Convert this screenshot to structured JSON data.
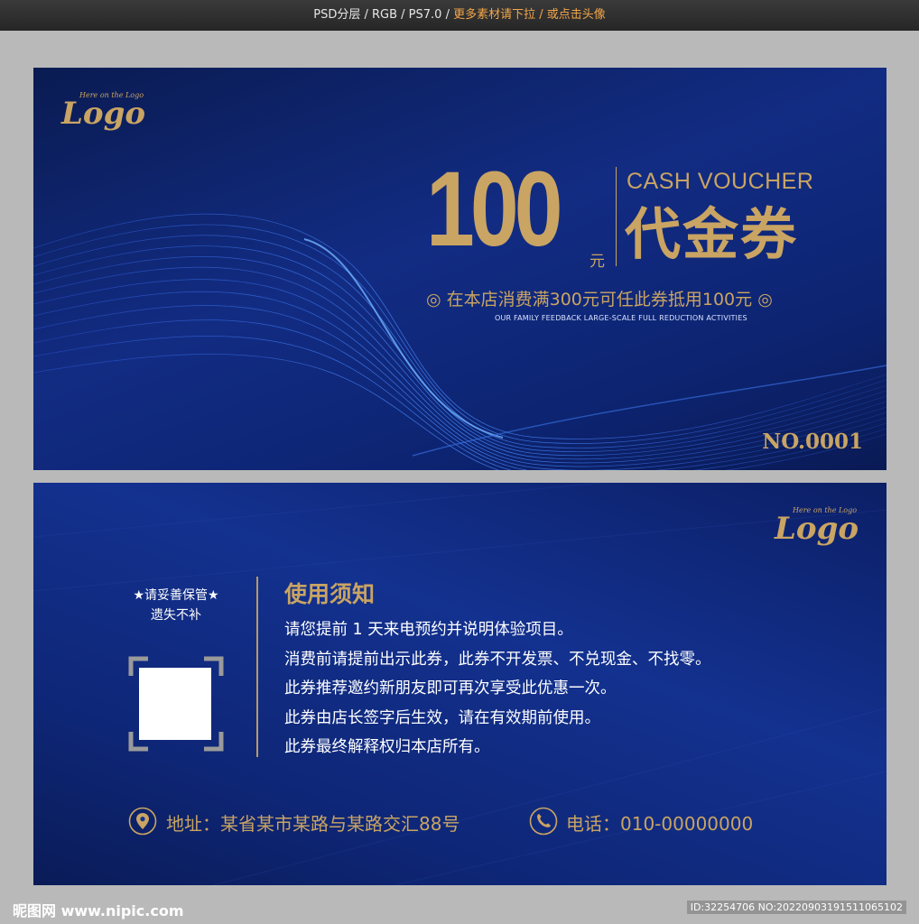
{
  "header": {
    "info": "PSD分层 / RGB / PS7.0 / ",
    "highlight": "更多素材请下拉 / 或点击头像"
  },
  "front": {
    "logo_small": "Here on the Logo",
    "logo_big": "Logo",
    "amount": "100",
    "amount_unit": "元",
    "cash_voucher": "CASH VOUCHER",
    "title_cn": "代金券",
    "promo": "◎ 在本店消费满300元可任此券抵用100元 ◎",
    "promo_en": "OUR FAMILY FEEDBACK LARGE-SCALE FULL REDUCTION ACTIVITIES",
    "serial": "NO.0001"
  },
  "back": {
    "logo_small": "Here on the Logo",
    "logo_big": "Logo",
    "keep_line1": "★请妥善保管★",
    "keep_line2": "遗失不补",
    "notice_title": "使用须知",
    "rules": [
      "请您提前 1 天来电预约并说明体验项目。",
      "消费前请提前出示此券，此券不开发票、不兑现金、不找零。",
      "此券推荐邀约新朋友即可再次享受此优惠一次。",
      "此券由店长签字后生效，请在有效期前使用。",
      "此券最终解释权归本店所有。"
    ],
    "address": "地址：某省某市某路与某路交汇88号",
    "phone": "电话：010-00000000"
  },
  "footer": {
    "watermark_left": "昵图网 www.nipic.com",
    "watermark_right": "ID:32254706 NO:20220903191511065102"
  },
  "colors": {
    "gold": "#c9a463",
    "navy": "#122c83"
  },
  "icons": [
    "location-icon",
    "phone-icon"
  ]
}
